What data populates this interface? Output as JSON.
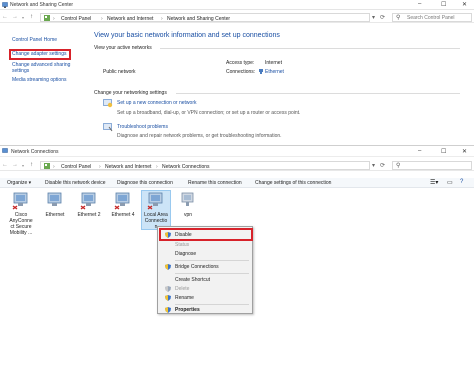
{
  "window1": {
    "title": "Network and Sharing Center",
    "address": [
      "Control Panel",
      "Network and Internet",
      "Network and Sharing Center"
    ],
    "search_placeholder": "Search Control Panel",
    "sidebar": {
      "home": "Control Panel Home",
      "change_adapter": "Change adapter settings",
      "change_sharing_1": "Change advanced sharing",
      "change_sharing_2": "settings",
      "media": "Media streaming options"
    },
    "main": {
      "heading": "View your basic network information and set up connections",
      "active_label": "View your active networks",
      "network_name": "Public network",
      "access_type_label": "Access type:",
      "access_type_value": "Internet",
      "connections_label": "Connections:",
      "connections_value": "Ethernet",
      "change_label": "Change your networking settings",
      "setup_link": "Set up a new connection or network",
      "setup_desc": "Set up a broadband, dial-up, or VPN connection; or set up a router or access point.",
      "troubleshoot_link": "Troubleshoot problems",
      "troubleshoot_desc": "Diagnose and repair network problems, or get troubleshooting information."
    }
  },
  "window2": {
    "title": "Network Connections",
    "address": [
      "Control Panel",
      "Network and Internet",
      "Network Connections"
    ],
    "toolbar": {
      "organize": "Organize ▾",
      "disable": "Disable this network device",
      "diagnose": "Diagnose this connection",
      "rename": "Rename this connection",
      "change": "Change settings of this connection"
    },
    "items": [
      {
        "line1": "Cisco",
        "line2": "AnyConne",
        "line3": "ct Secure",
        "line4": "Mobility ...",
        "status": "disabled-x"
      },
      {
        "line1": "Ethernet",
        "line2": "",
        "line3": "",
        "line4": "",
        "status": "ok"
      },
      {
        "line1": "Ethernet 2",
        "line2": "",
        "line3": "",
        "line4": "",
        "status": "x"
      },
      {
        "line1": "Ethernet 4",
        "line2": "",
        "line3": "",
        "line4": "",
        "status": "x"
      },
      {
        "line1": "Local Area",
        "line2": "Connectio",
        "line3": "n",
        "line4": "",
        "status": "x"
      },
      {
        "line1": "vpn",
        "line2": "",
        "line3": "",
        "line4": "",
        "status": "ok"
      }
    ],
    "context_menu": {
      "disable": "Disable",
      "status": "Status",
      "diagnose": "Diagnose",
      "bridge": "Bridge Connections",
      "shortcut": "Create Shortcut",
      "delete": "Delete",
      "rename": "Rename",
      "properties": "Properties"
    }
  },
  "colors": {
    "accent_link": "#1a4fa3",
    "highlight_red": "#d7222a",
    "selection_blue": "#cce4f7"
  }
}
